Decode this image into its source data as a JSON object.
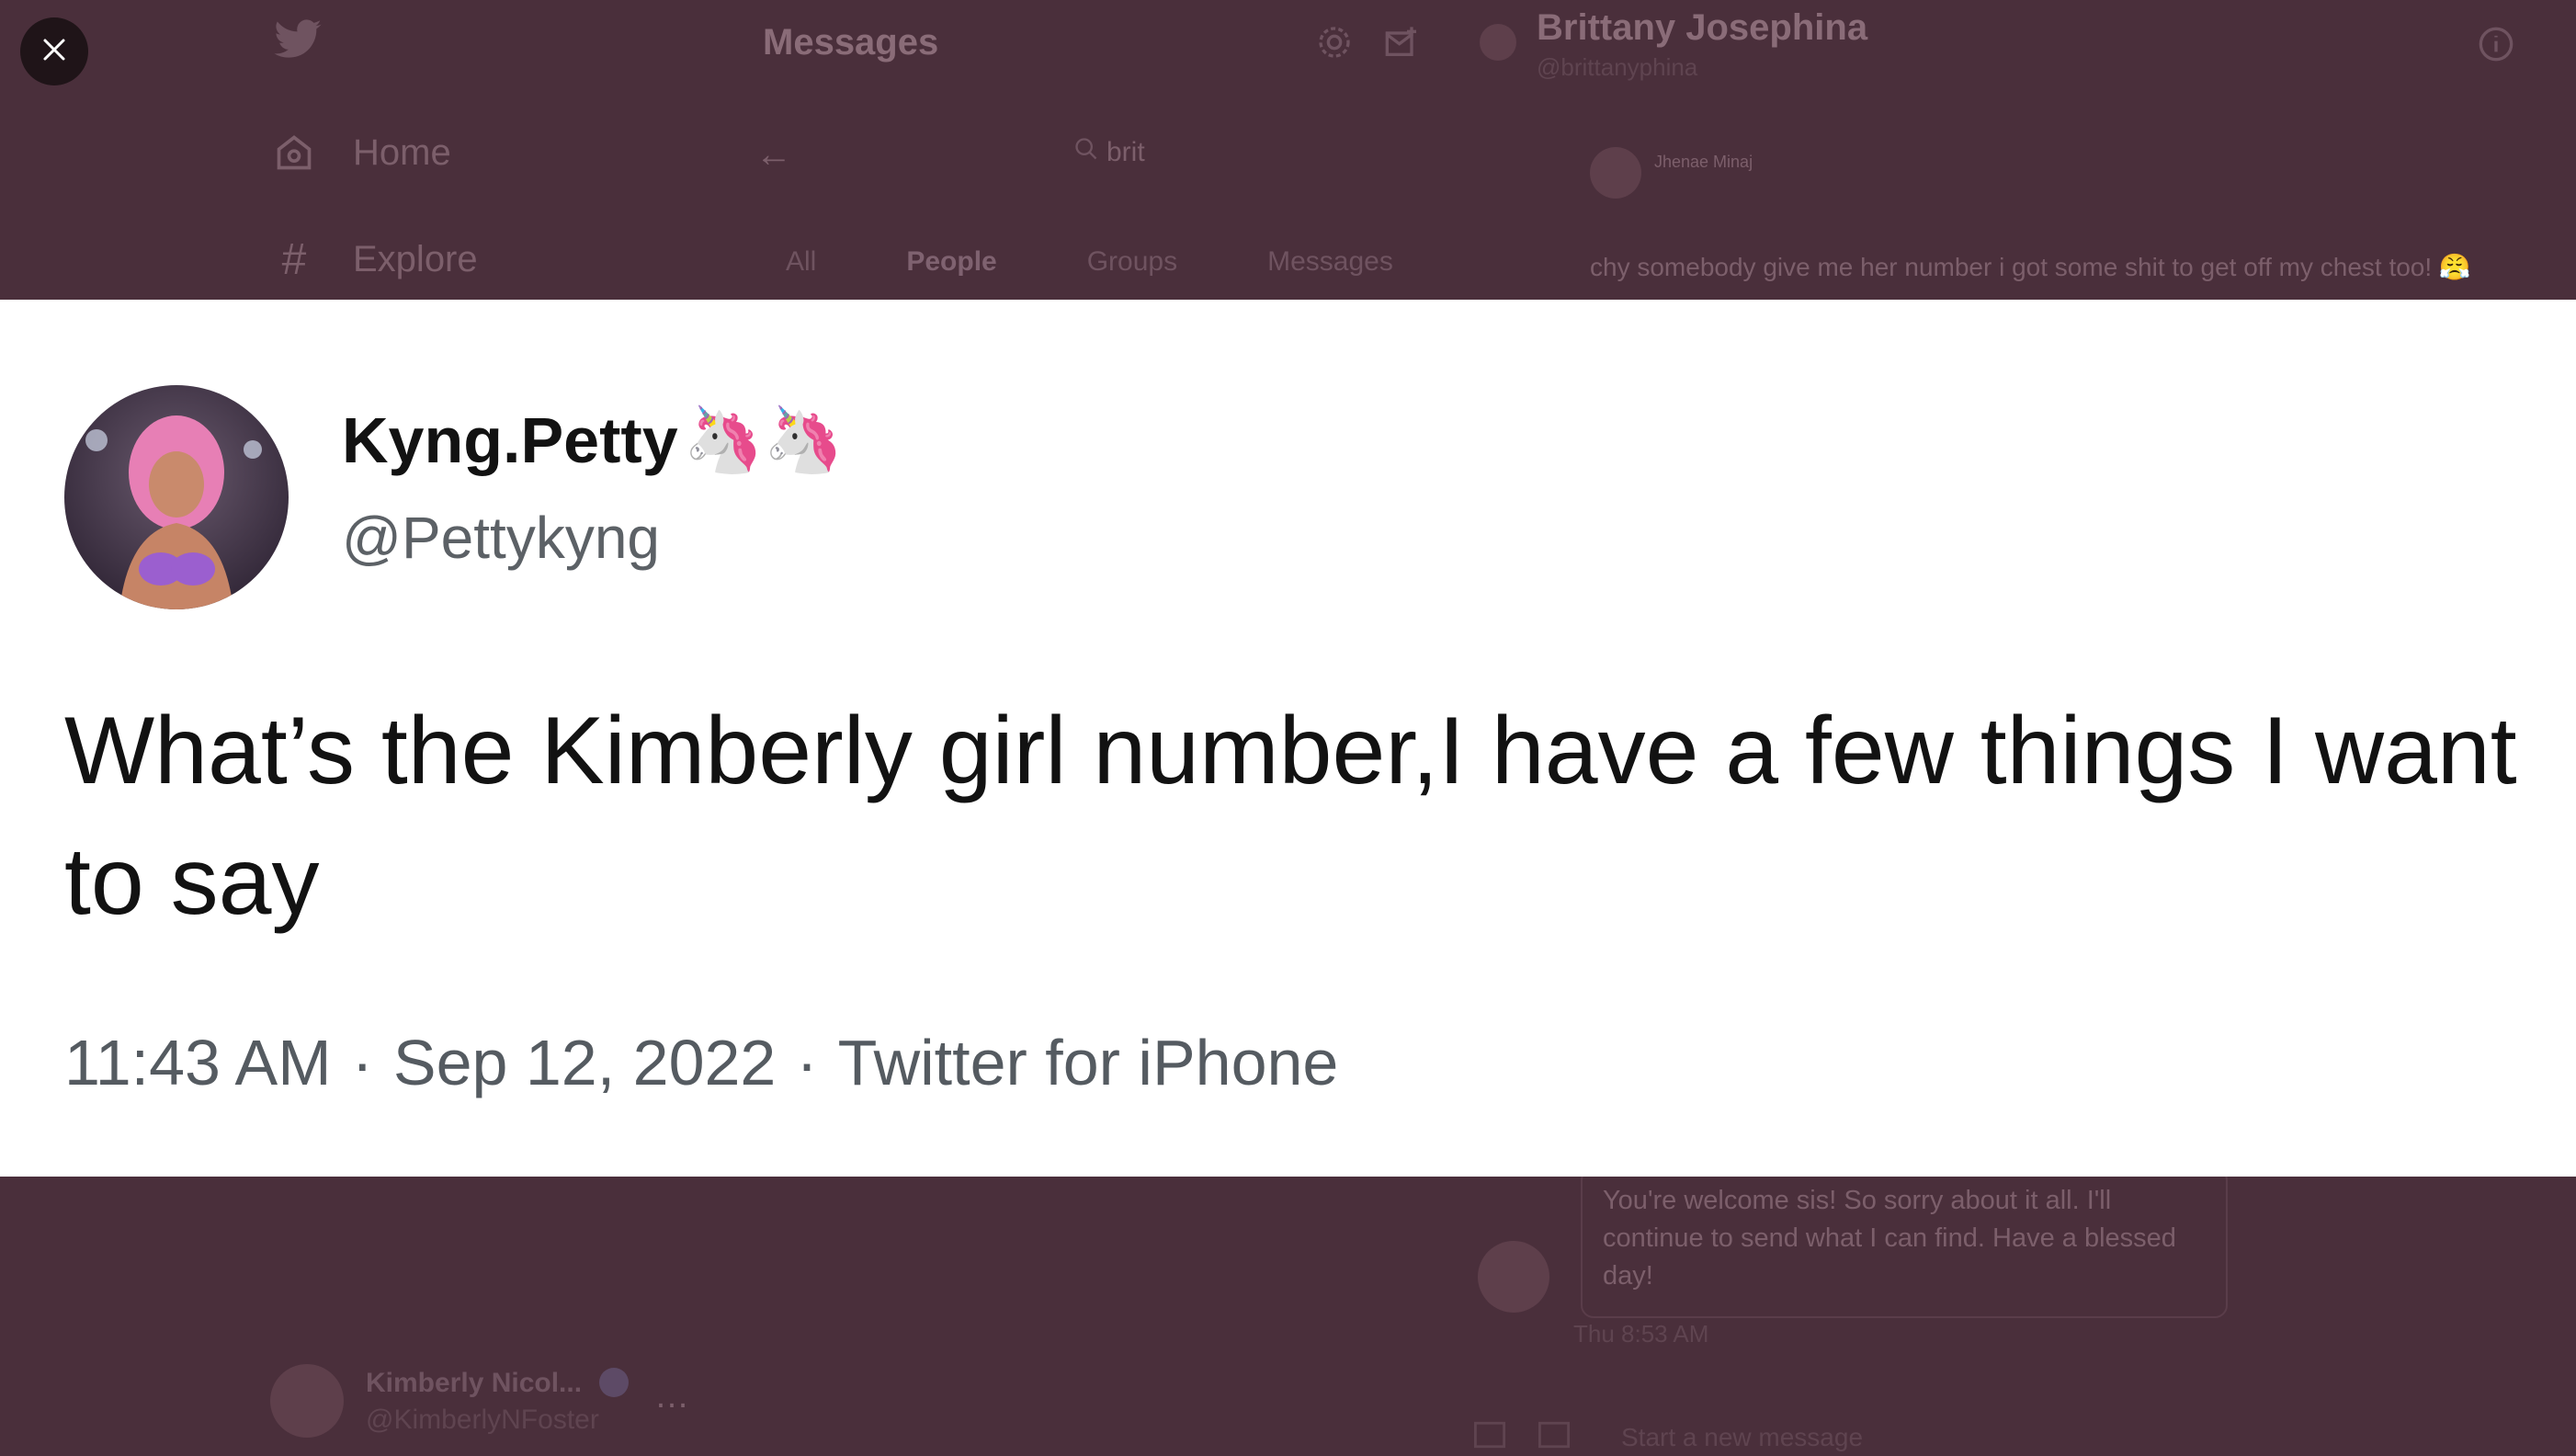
{
  "app": {
    "header_title": "Messages",
    "nav": [
      {
        "label": "Home",
        "icon": "home-icon"
      },
      {
        "label": "Explore",
        "icon": "hashtag-icon"
      }
    ],
    "search_value": "brit",
    "tabs": [
      "All",
      "People",
      "Groups",
      "Messages"
    ],
    "conversation": {
      "name": "Brittany Josephina",
      "handle": "@brittanyphina",
      "quoted_name": "Jhenae Minaj",
      "quoted_text": "chy somebody give me her number i got some shit to get off my chest too! 😤",
      "message": "You're welcome sis! So sorry about it all. I'll continue to send what I can find. Have a blessed day!",
      "message_time": "Thu 8:53 AM",
      "composer_placeholder": "Start a new message"
    },
    "account": {
      "name": "Kimberly Nicol...",
      "handle": "@KimberlyNFoster"
    }
  },
  "tweet": {
    "name": "Kyng.Petty",
    "name_emoji": "🦄🦄",
    "handle": "@Pettykyng",
    "text": "What’s the Kimberly girl number,I have a few things I want to say",
    "time": "11:43 AM",
    "date": "Sep 12, 2022",
    "source": "Twitter for iPhone",
    "separator": "·"
  },
  "colors": {
    "backdrop": "#4a2f3b",
    "card": "#ffffff",
    "tweet_text": "#121212",
    "meta_text": "#555b61"
  }
}
